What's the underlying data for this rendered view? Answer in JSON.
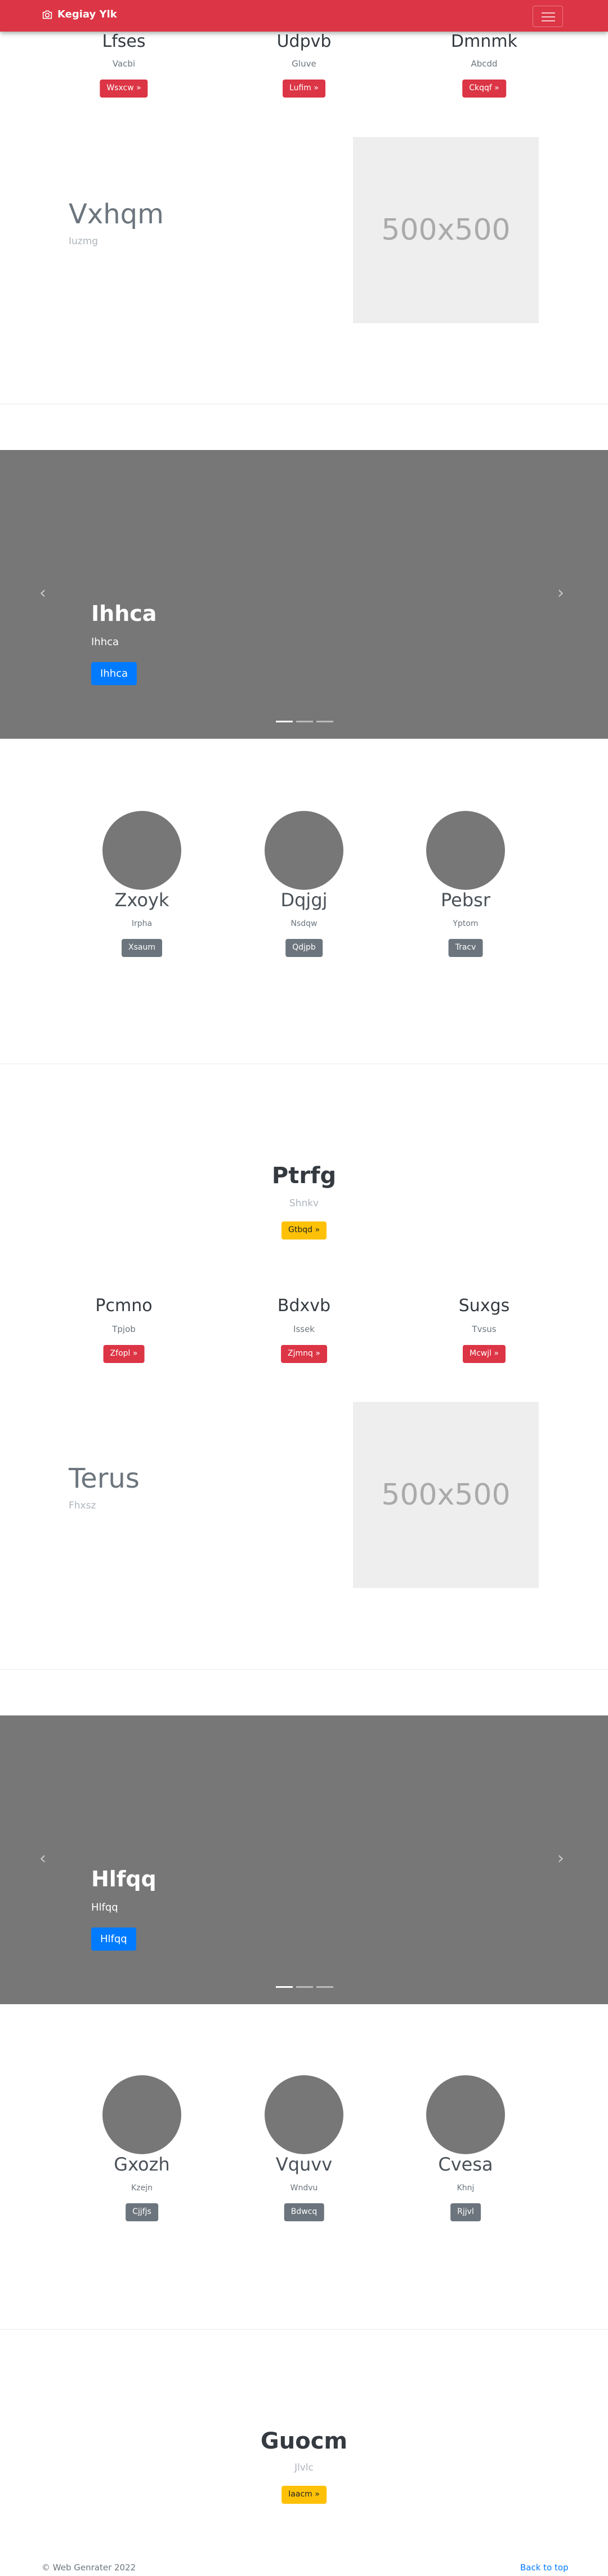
{
  "nav": {
    "brand": "Kegiay Ylk"
  },
  "features1": [
    {
      "title": "Lfses",
      "sub": "Vacbi",
      "button": "Wsxcw »"
    },
    {
      "title": "Udpvb",
      "sub": "Gluve",
      "button": "Lufim »"
    },
    {
      "title": "Dmnmk",
      "sub": "Abcdd",
      "button": "Ckqqf »"
    }
  ],
  "hero1": {
    "title": "Vxhqm",
    "sub": "Iuzmg",
    "placeholder": "500x500"
  },
  "carousel1": {
    "title": "Ihhca",
    "sub": "Ihhca",
    "button": "Ihhca"
  },
  "team1": [
    {
      "name": "Zxoyk",
      "sub": "Irpha",
      "button": "Xsaum"
    },
    {
      "name": "Dqjgj",
      "sub": "Nsdqw",
      "button": "Qdjpb"
    },
    {
      "name": "Pebsr",
      "sub": "Yptom",
      "button": "Tracv"
    }
  ],
  "cta1": {
    "title": "Ptrfg",
    "sub": "Shnkv",
    "button": "Gtbqd »"
  },
  "features2": [
    {
      "title": "Pcmno",
      "sub": "Tpjob",
      "button": "Zfopl »"
    },
    {
      "title": "Bdxvb",
      "sub": "Issek",
      "button": "Zjmnq »"
    },
    {
      "title": "Suxgs",
      "sub": "Tvsus",
      "button": "Mcwjl »"
    }
  ],
  "hero2": {
    "title": "Terus",
    "sub": "Fhxsz",
    "placeholder": "500x500"
  },
  "carousel2": {
    "title": "Hlfqq",
    "sub": "Hlfqq",
    "button": "Hlfqq"
  },
  "team2": [
    {
      "name": "Gxozh",
      "sub": "Kzejn",
      "button": "Cjjfjs"
    },
    {
      "name": "Vquvv",
      "sub": "Wndvu",
      "button": "Bdwcq"
    },
    {
      "name": "Cvesa",
      "sub": "Khnj",
      "button": "Rjjvl"
    }
  ],
  "cta2": {
    "title": "Guocm",
    "sub": "Jlvlc",
    "button": "Iaacm »"
  },
  "footer": {
    "copyright": "© Web Genrater 2022",
    "back_to_top": "Back to top"
  },
  "colors": {
    "navbar": "#dc3545",
    "carousel": "#777777",
    "primary": "#007bff",
    "warning": "#ffc107",
    "secondary": "#6c757d"
  },
  "icons": {
    "brand": "camera-icon",
    "menu": "hamburger-icon",
    "prev": "chevron-left-icon",
    "next": "chevron-right-icon"
  }
}
